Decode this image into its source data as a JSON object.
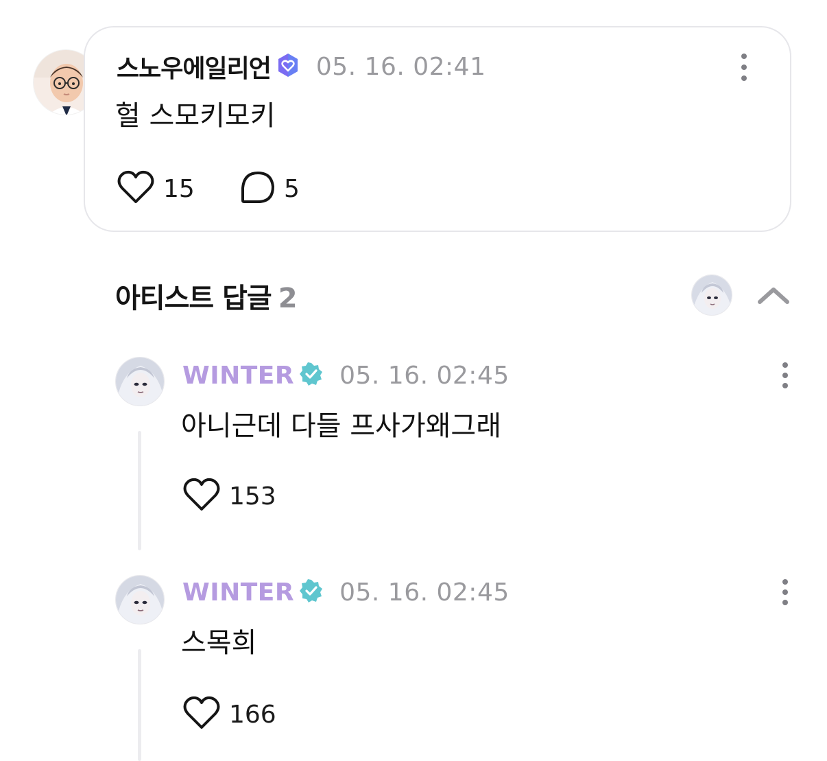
{
  "fan_comment": {
    "author": "스노우에일리언",
    "timestamp": "05. 16. 02:41",
    "text": "헐 스모키모키",
    "like_count": "15",
    "reply_count": "5",
    "badge_icon": "verified-heart-badge-icon",
    "badge_color": "#7b6cf2"
  },
  "artist_replies": {
    "title": "아티스트 답글",
    "count": "2",
    "replies": [
      {
        "author": "WINTER",
        "timestamp": "05. 16. 02:45",
        "text": "아니근데 다들 프사가왜그래",
        "like_count": "153"
      },
      {
        "author": "WINTER",
        "timestamp": "05. 16. 02:45",
        "text": "스목희",
        "like_count": "166"
      }
    ]
  },
  "colors": {
    "artist_name": "#b59be0",
    "artist_badge": "#5fc6cf",
    "timestamp": "#9a9a9e",
    "card_border": "#e6e6ea"
  }
}
